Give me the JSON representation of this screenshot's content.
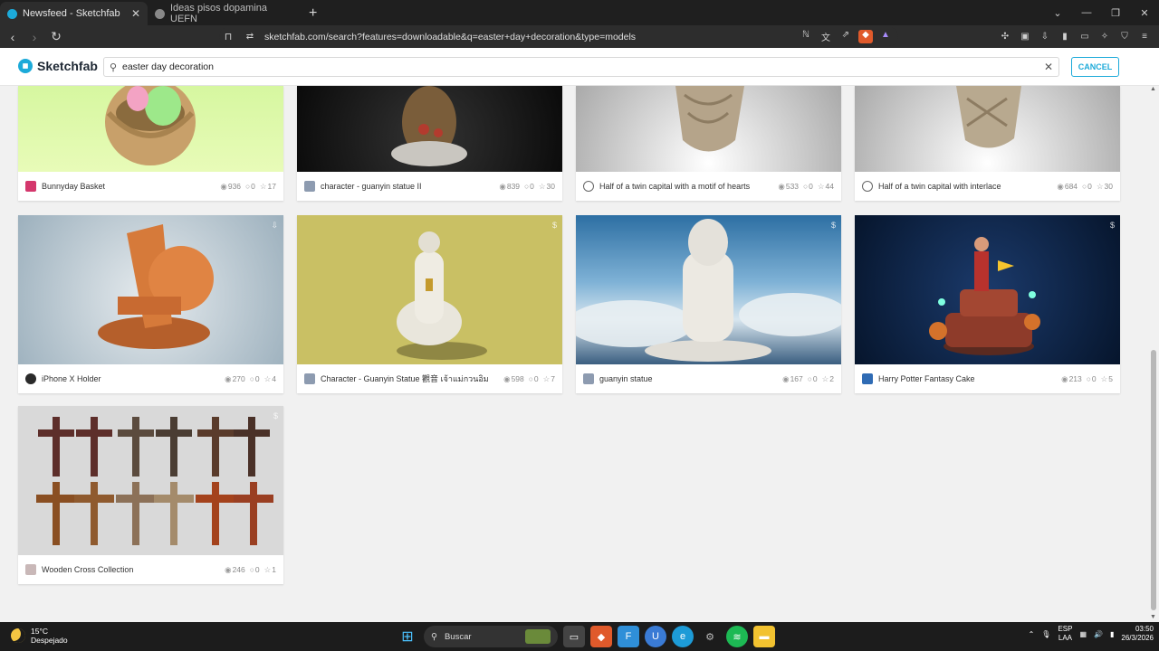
{
  "browser": {
    "tabs": [
      {
        "title": "Newsfeed - Sketchfab",
        "active": true,
        "favicon_color": "#1caad9"
      },
      {
        "title": "Ideas pisos dopamina UEFN",
        "active": false,
        "favicon_color": "#bdbdbd"
      }
    ],
    "new_tab": "+",
    "url": "sketchfab.com/search?features=downloadable&q=easter+day+decoration&type=models"
  },
  "header": {
    "logo_text": "Sketchfab",
    "search_value": "easter day decoration",
    "cancel_label": "CANCEL"
  },
  "models": [
    {
      "title": "Bunnyday Basket",
      "views": "936",
      "comments": "0",
      "likes": "17",
      "avatar_color": "#d4376c"
    },
    {
      "title": "character - guanyin statue II",
      "views": "839",
      "comments": "0",
      "likes": "30",
      "avatar_color": "#8d9bb0"
    },
    {
      "title": "Half of a twin capital with a motif of hearts",
      "views": "533",
      "comments": "0",
      "likes": "44",
      "avatar_color": "#ffffff"
    },
    {
      "title": "Half of a twin capital with interlace",
      "views": "684",
      "comments": "0",
      "likes": "30",
      "avatar_color": "#ffffff"
    },
    {
      "title": "iPhone X Holder",
      "views": "270",
      "comments": "0",
      "likes": "4",
      "avatar_color": "#2a2a2a"
    },
    {
      "title": "Character - Guanyin Statue 觀音 เจ้าแม่กวนอิม",
      "views": "598",
      "comments": "0",
      "likes": "7",
      "avatar_color": "#8d9bb0"
    },
    {
      "title": "guanyin statue",
      "views": "167",
      "comments": "0",
      "likes": "2",
      "avatar_color": "#8d9bb0"
    },
    {
      "title": "Harry Potter Fantasy Cake",
      "views": "213",
      "comments": "0",
      "likes": "5",
      "avatar_color": "#2f6bb4"
    },
    {
      "title": "Wooden Cross Collection",
      "views": "246",
      "comments": "0",
      "likes": "1",
      "avatar_color": "#c9b8b8"
    }
  ],
  "taskbar": {
    "temperature": "15°C",
    "weather": "Despejado",
    "search_placeholder": "Buscar",
    "lang_top": "ESP",
    "lang_bottom": "LAA",
    "time": "03:50",
    "date": "26/3/2026"
  },
  "colors": {
    "accent": "#1caad9",
    "taskbar": "#1c1c1c",
    "browser_chrome": "#2d2d2d"
  }
}
